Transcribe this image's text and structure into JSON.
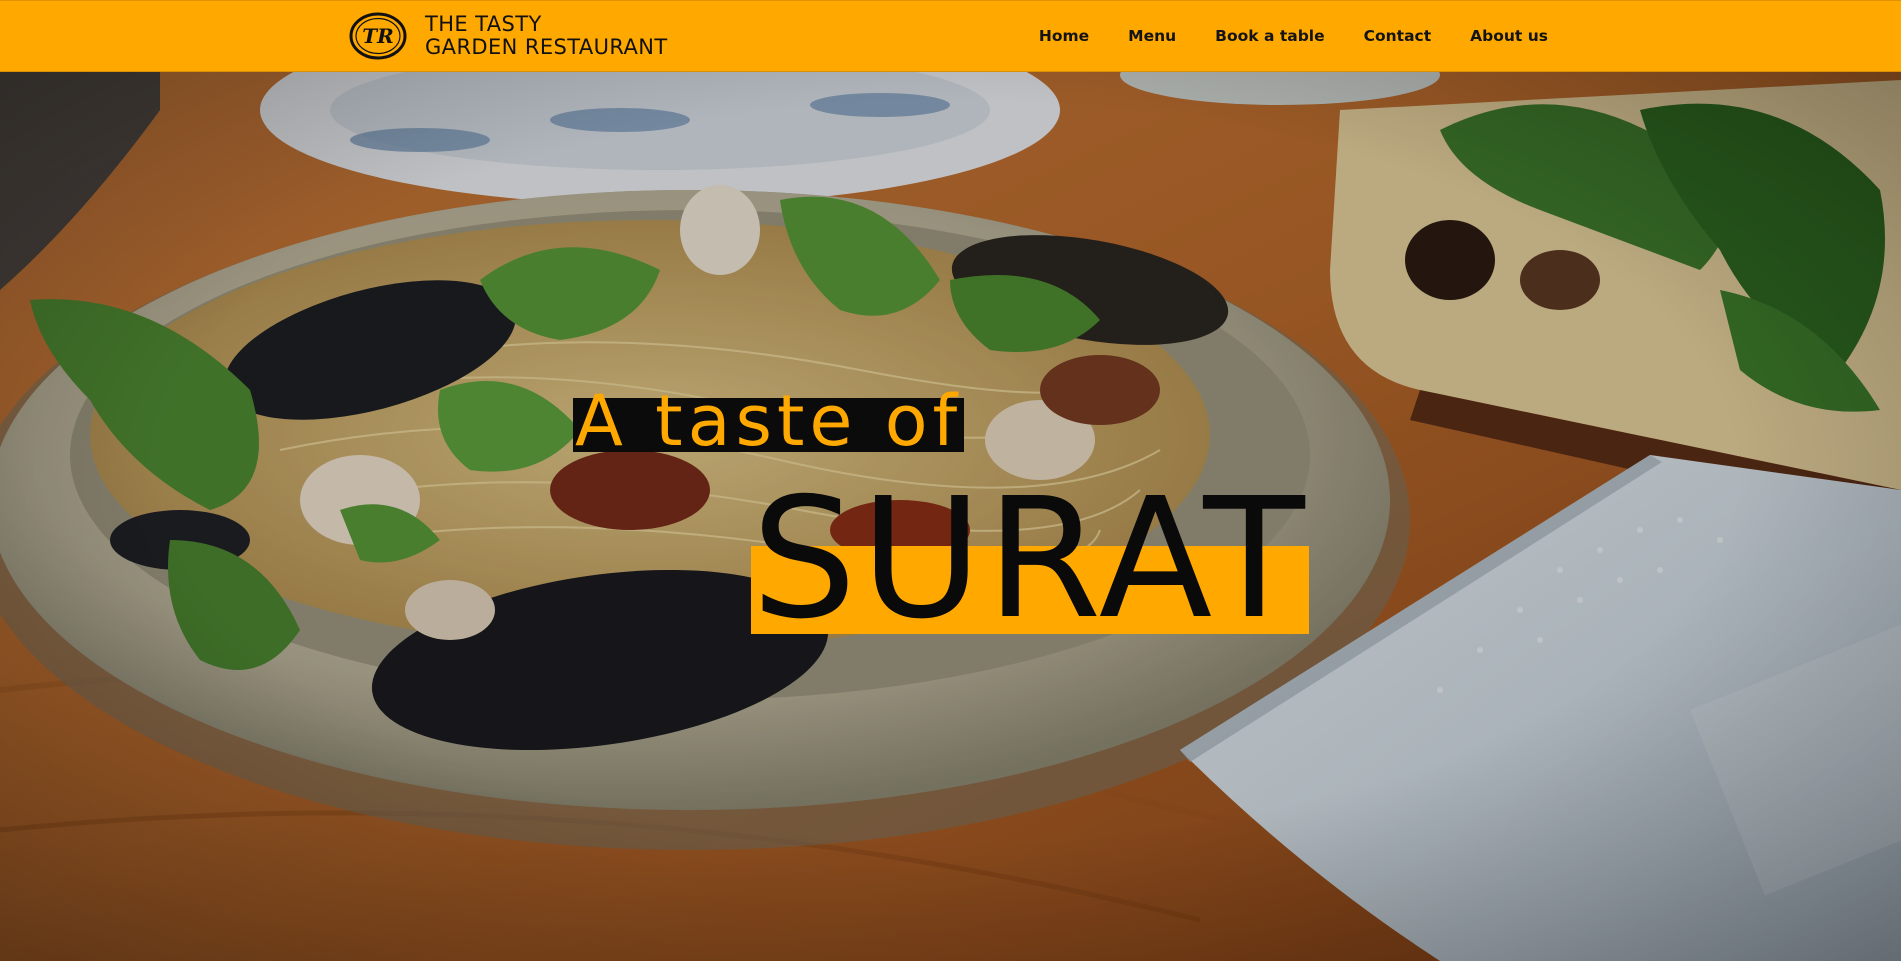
{
  "brand": {
    "logo_letters": "TR",
    "line1": "THE TASTY",
    "line2": "GARDEN RESTAURANT"
  },
  "nav": {
    "items": [
      "Home",
      "Menu",
      "Book a table",
      "Contact",
      "About us"
    ]
  },
  "hero": {
    "tagline": "A taste of",
    "city": "SURAT",
    "image": "pasta-dish-photo"
  },
  "colors": {
    "accent": "#ffa800",
    "dark": "#0b0b0b"
  }
}
